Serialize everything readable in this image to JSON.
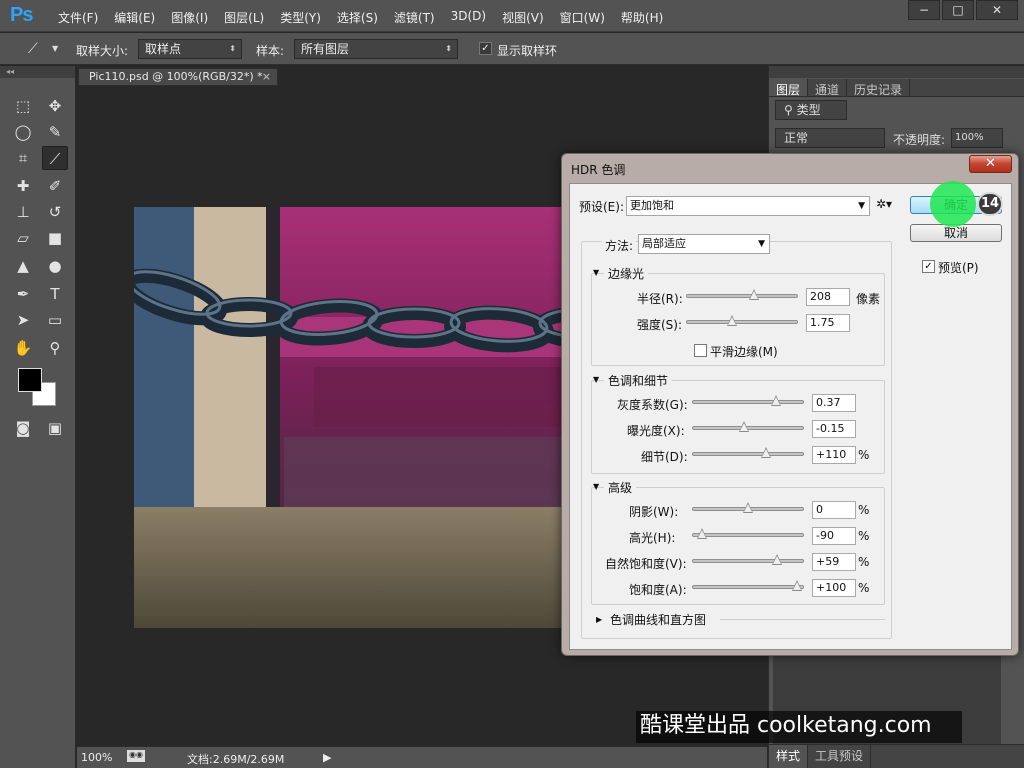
{
  "app": {
    "logo": "Ps",
    "menu": [
      "文件(F)",
      "编辑(E)",
      "图像(I)",
      "图层(L)",
      "类型(Y)",
      "选择(S)",
      "滤镜(T)",
      "3D(D)",
      "视图(V)",
      "窗口(W)",
      "帮助(H)"
    ],
    "window_buttons": [
      "−",
      "□",
      "✕"
    ]
  },
  "options_bar": {
    "sample_size_label": "取样大小:",
    "sample_size_value": "取样点",
    "sample_label": "样本:",
    "sample_value": "所有图层",
    "show_ring_label": "显示取样环",
    "show_ring_checked": "✓"
  },
  "document": {
    "tab_title": "Pic110.psd @ 100%(RGB/32*) *",
    "tab_close": "×",
    "zoom": "100%",
    "doc_info": "文档:2.69M/2.69M"
  },
  "right_panel": {
    "tabs": [
      "图层",
      "通道",
      "历史记录"
    ],
    "filter_kind": "类型",
    "blend_mode": "正常",
    "opacity_label": "不透明度:",
    "opacity_value": "100%",
    "bottom_tabs": [
      "样式",
      "工具预设"
    ]
  },
  "dialog": {
    "title": "HDR 色调",
    "close": "✕",
    "preset_label": "预设(E):",
    "preset_value": "更加饱和",
    "ok_label": "确定",
    "cancel_label": "取消",
    "preview_label": "预览(P)",
    "preview_checked": "✓",
    "method_label": "方法:",
    "method_value": "局部适应",
    "edge_glow": {
      "title": "边缘光",
      "radius_label": "半径(R):",
      "radius_value": "208",
      "radius_unit": "像素",
      "radius_fraction": 0.62,
      "strength_label": "强度(S):",
      "strength_value": "1.75",
      "strength_fraction": 0.4,
      "smooth_label": "平滑边缘(M)"
    },
    "tone_detail": {
      "title": "色调和细节",
      "gamma_label": "灰度系数(G):",
      "gamma_value": "0.37",
      "gamma_fraction": 0.78,
      "exposure_label": "曝光度(X):",
      "exposure_value": "-0.15",
      "exposure_fraction": 0.46,
      "detail_label": "细节(D):",
      "detail_value": "+110",
      "detail_fraction": 0.68,
      "pct": "%"
    },
    "advanced": {
      "title": "高级",
      "shadow_label": "阴影(W):",
      "shadow_value": "0",
      "shadow_fraction": 0.5,
      "highlight_label": "高光(H):",
      "highlight_value": "-90",
      "highlight_fraction": 0.04,
      "vibrance_label": "自然饱和度(V):",
      "vibrance_value": "+59",
      "vibrance_fraction": 0.79,
      "saturation_label": "饱和度(A):",
      "saturation_value": "+100",
      "saturation_fraction": 0.99,
      "pct": "%"
    },
    "curve_section": "色调曲线和直方图"
  },
  "overlay": {
    "step_badge": "14",
    "watermark": "酷课堂出品 coolketang.com"
  }
}
